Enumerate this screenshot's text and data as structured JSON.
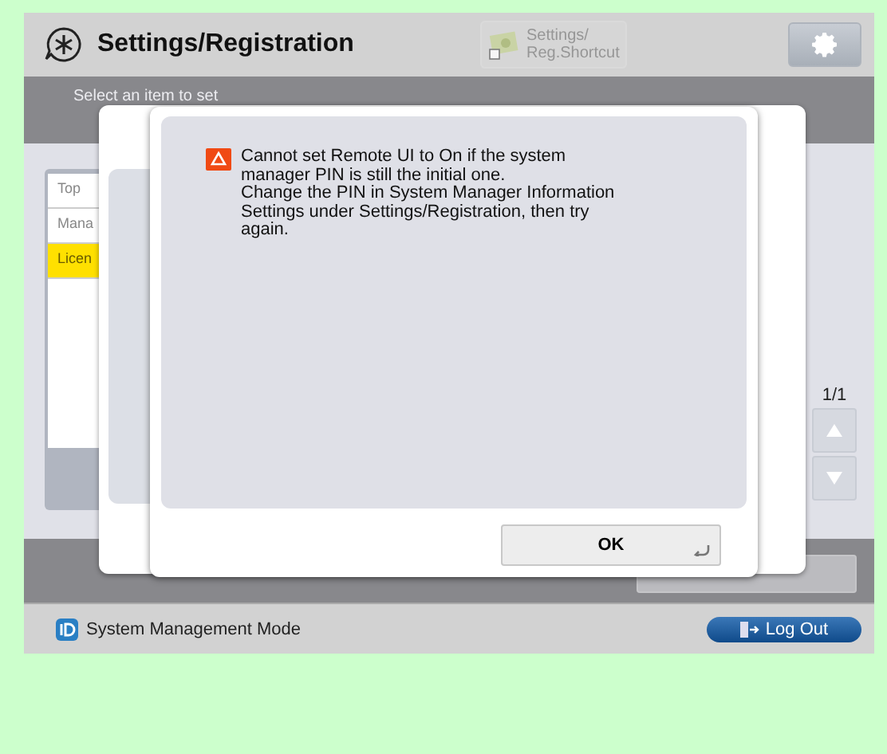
{
  "header": {
    "title": "Settings/Registration",
    "shortcut": {
      "lines": [
        "Settings/",
        "Reg.Shortcut"
      ],
      "disabled": true
    }
  },
  "instruction": "Select an item to set",
  "list": [
    {
      "label": "Top",
      "selected": false
    },
    {
      "label": "Mana",
      "selected": false
    },
    {
      "label": "Licen",
      "selected": true
    }
  ],
  "pager": {
    "page": "1/1"
  },
  "dialog": {
    "paragraphs": [
      "Cannot set Remote UI to On if the system manager PIN is still the initial one.",
      "Change the PIN in System Manager Information Settings under Settings/Registration, then try again."
    ],
    "button": "OK"
  },
  "footer": {
    "mode": "System Management Mode",
    "logout": "Log Out"
  }
}
